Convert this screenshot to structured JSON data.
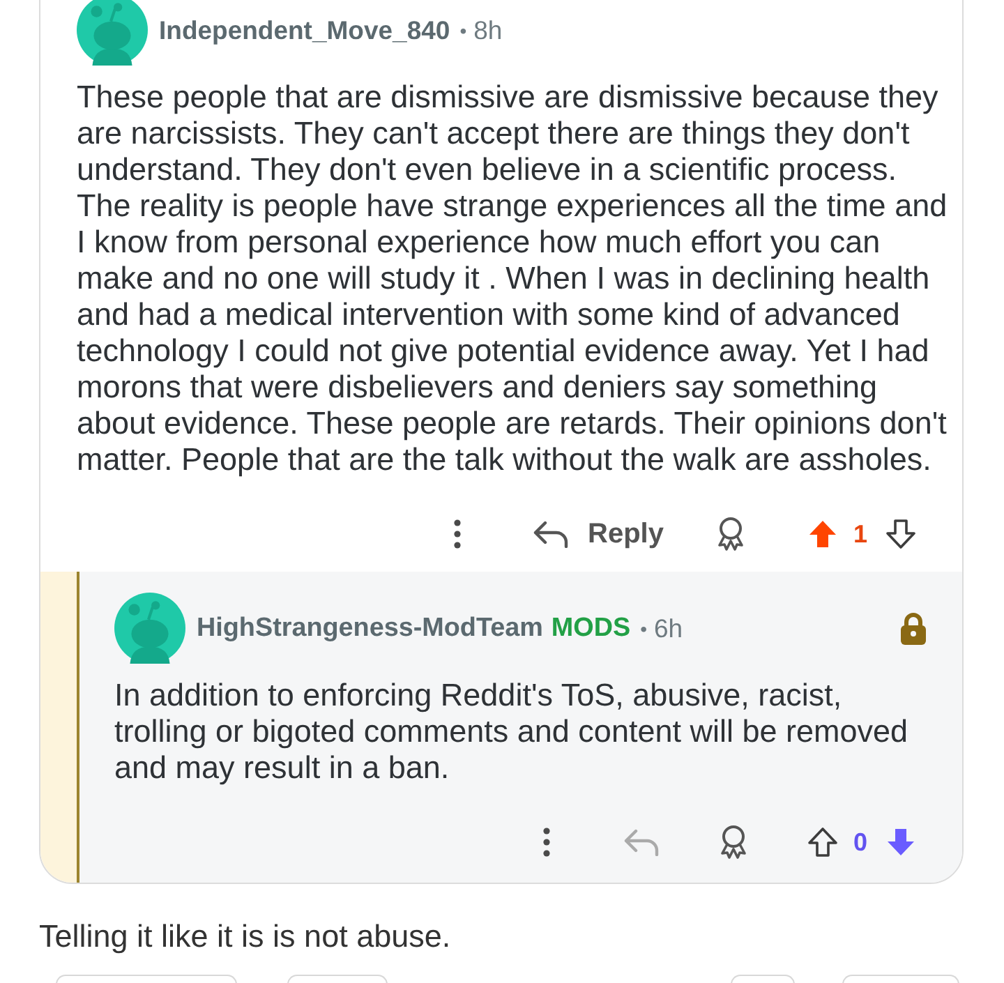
{
  "thread": {
    "author": "Independent_Move_840",
    "separator": "•",
    "time": "8h",
    "body": "These people that are dismissive are dismissive because they are narcissists. They can't accept there are things they don't understand. They don't even believe in a scientific process. The reality is people have strange experiences all the time and I know from personal experience how much effort you can make and no one will study it . When I was in declining health and had a medical intervention with some kind of advanced technology I could not give potential evidence away. Yet I had morons that were disbelievers and deniers say something about evidence. These people are retards. Their opinions don't matter. People that are the talk without the walk are assholes.",
    "reply_label": "Reply",
    "reply_disabled": false,
    "upvoted": true,
    "downvoted": false,
    "score": "1",
    "replies": [
      {
        "author": "HighStrangeness-ModTeam",
        "badge": "MODS",
        "separator": "•",
        "time": "6h",
        "locked": true,
        "body": "In addition to enforcing Reddit's ToS, abusive, racist, trolling or bigoted comments and content will be removed and may result in a ban.",
        "reply_disabled": true,
        "upvoted": false,
        "downvoted": true,
        "score": "0"
      }
    ]
  },
  "caption": "Telling it like it is is not abuse."
}
